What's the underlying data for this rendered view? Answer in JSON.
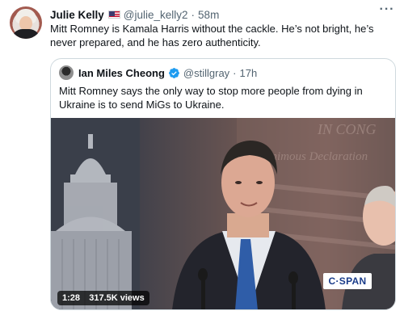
{
  "tweet": {
    "author_name": "Julie Kelly",
    "flag_icon": "us-flag-icon",
    "handle": "@julie_kelly2",
    "separator": "·",
    "time": "58m",
    "more_label": "···",
    "text": "Mitt Romney is Kamala Harris without the cackle. He’s not bright, he’s never prepared, and he has zero authenticity."
  },
  "quoted_tweet": {
    "author_name": "Ian Miles Cheong",
    "verified_icon": "verified-badge-icon",
    "handle": "@stillgray",
    "separator": "·",
    "time": "17h",
    "text": "Mitt Romney says the only way to stop more people from dying in Ukraine is to send MiGs to Ukraine.",
    "media": {
      "type": "video",
      "duration": "1:28",
      "views": "317.5K views",
      "channel_logo_text": "C·SPAN",
      "background_text_1": "IN CONG",
      "background_text_2": "unanimous Declaration"
    }
  },
  "colors": {
    "text_primary": "#0f1419",
    "text_secondary": "#536471",
    "border": "#cfd9de",
    "verified_blue": "#1d9bf0"
  }
}
